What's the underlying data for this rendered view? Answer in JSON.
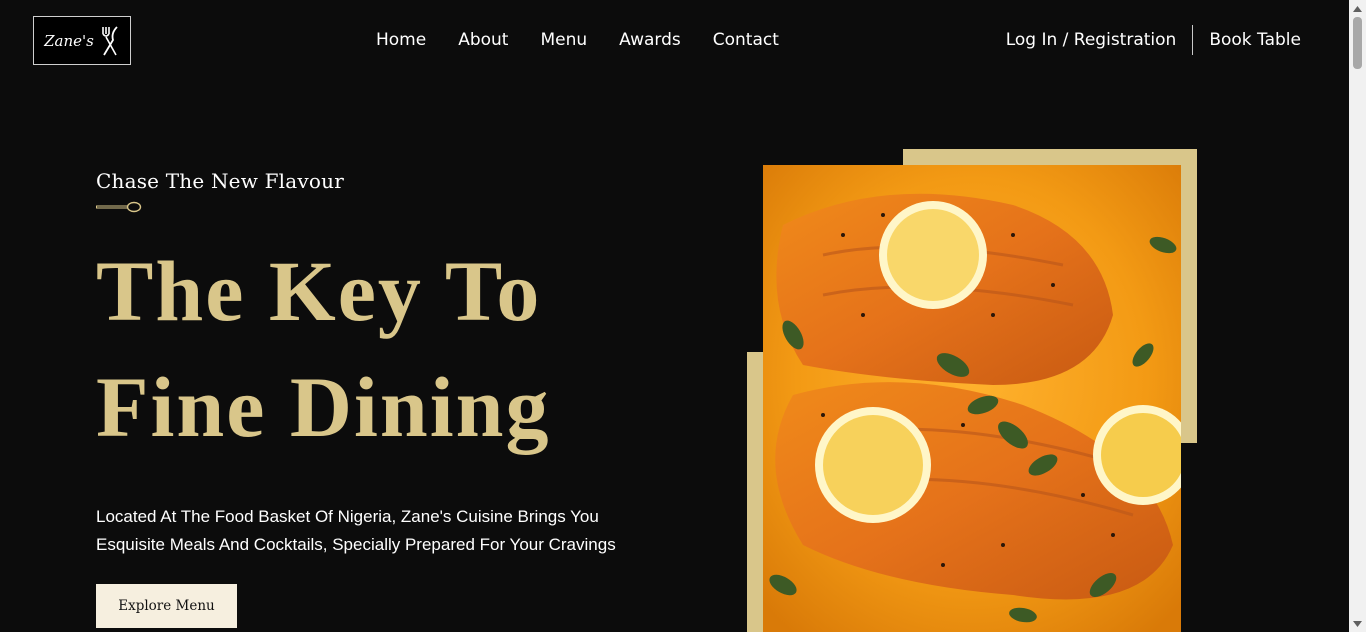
{
  "brand": {
    "logo_text": "Zane's"
  },
  "nav": {
    "links": [
      "Home",
      "About",
      "Menu",
      "Awards",
      "Contact"
    ],
    "login": "Log In / Registration",
    "book": "Book Table"
  },
  "hero": {
    "subtitle": "Chase The New Flavour",
    "title_line1": "The Key To",
    "title_line2": "Fine Dining",
    "description": "Located At The Food Basket Of Nigeria, Zane's Cuisine Brings You Esquisite Meals And Cocktails, Specially Prepared For Your Cravings",
    "cta": "Explore Menu"
  },
  "colors": {
    "background": "#0c0c0c",
    "accent": "#d9c68a",
    "button_bg": "#f6efdf"
  },
  "icons": {
    "logo": "fork-knife-icon",
    "divider": "spoon-icon"
  }
}
